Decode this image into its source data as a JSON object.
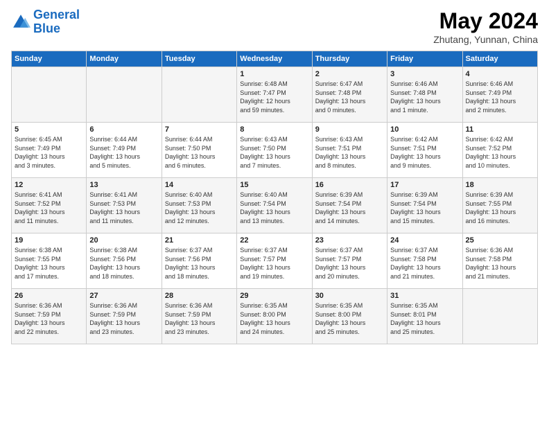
{
  "logo": {
    "line1": "General",
    "line2": "Blue"
  },
  "title": "May 2024",
  "subtitle": "Zhutang, Yunnan, China",
  "days_header": [
    "Sunday",
    "Monday",
    "Tuesday",
    "Wednesday",
    "Thursday",
    "Friday",
    "Saturday"
  ],
  "weeks": [
    [
      {
        "day": "",
        "content": ""
      },
      {
        "day": "",
        "content": ""
      },
      {
        "day": "",
        "content": ""
      },
      {
        "day": "1",
        "content": "Sunrise: 6:48 AM\nSunset: 7:47 PM\nDaylight: 12 hours\nand 59 minutes."
      },
      {
        "day": "2",
        "content": "Sunrise: 6:47 AM\nSunset: 7:48 PM\nDaylight: 13 hours\nand 0 minutes."
      },
      {
        "day": "3",
        "content": "Sunrise: 6:46 AM\nSunset: 7:48 PM\nDaylight: 13 hours\nand 1 minute."
      },
      {
        "day": "4",
        "content": "Sunrise: 6:46 AM\nSunset: 7:49 PM\nDaylight: 13 hours\nand 2 minutes."
      }
    ],
    [
      {
        "day": "5",
        "content": "Sunrise: 6:45 AM\nSunset: 7:49 PM\nDaylight: 13 hours\nand 3 minutes."
      },
      {
        "day": "6",
        "content": "Sunrise: 6:44 AM\nSunset: 7:49 PM\nDaylight: 13 hours\nand 5 minutes."
      },
      {
        "day": "7",
        "content": "Sunrise: 6:44 AM\nSunset: 7:50 PM\nDaylight: 13 hours\nand 6 minutes."
      },
      {
        "day": "8",
        "content": "Sunrise: 6:43 AM\nSunset: 7:50 PM\nDaylight: 13 hours\nand 7 minutes."
      },
      {
        "day": "9",
        "content": "Sunrise: 6:43 AM\nSunset: 7:51 PM\nDaylight: 13 hours\nand 8 minutes."
      },
      {
        "day": "10",
        "content": "Sunrise: 6:42 AM\nSunset: 7:51 PM\nDaylight: 13 hours\nand 9 minutes."
      },
      {
        "day": "11",
        "content": "Sunrise: 6:42 AM\nSunset: 7:52 PM\nDaylight: 13 hours\nand 10 minutes."
      }
    ],
    [
      {
        "day": "12",
        "content": "Sunrise: 6:41 AM\nSunset: 7:52 PM\nDaylight: 13 hours\nand 11 minutes."
      },
      {
        "day": "13",
        "content": "Sunrise: 6:41 AM\nSunset: 7:53 PM\nDaylight: 13 hours\nand 11 minutes."
      },
      {
        "day": "14",
        "content": "Sunrise: 6:40 AM\nSunset: 7:53 PM\nDaylight: 13 hours\nand 12 minutes."
      },
      {
        "day": "15",
        "content": "Sunrise: 6:40 AM\nSunset: 7:54 PM\nDaylight: 13 hours\nand 13 minutes."
      },
      {
        "day": "16",
        "content": "Sunrise: 6:39 AM\nSunset: 7:54 PM\nDaylight: 13 hours\nand 14 minutes."
      },
      {
        "day": "17",
        "content": "Sunrise: 6:39 AM\nSunset: 7:54 PM\nDaylight: 13 hours\nand 15 minutes."
      },
      {
        "day": "18",
        "content": "Sunrise: 6:39 AM\nSunset: 7:55 PM\nDaylight: 13 hours\nand 16 minutes."
      }
    ],
    [
      {
        "day": "19",
        "content": "Sunrise: 6:38 AM\nSunset: 7:55 PM\nDaylight: 13 hours\nand 17 minutes."
      },
      {
        "day": "20",
        "content": "Sunrise: 6:38 AM\nSunset: 7:56 PM\nDaylight: 13 hours\nand 18 minutes."
      },
      {
        "day": "21",
        "content": "Sunrise: 6:37 AM\nSunset: 7:56 PM\nDaylight: 13 hours\nand 18 minutes."
      },
      {
        "day": "22",
        "content": "Sunrise: 6:37 AM\nSunset: 7:57 PM\nDaylight: 13 hours\nand 19 minutes."
      },
      {
        "day": "23",
        "content": "Sunrise: 6:37 AM\nSunset: 7:57 PM\nDaylight: 13 hours\nand 20 minutes."
      },
      {
        "day": "24",
        "content": "Sunrise: 6:37 AM\nSunset: 7:58 PM\nDaylight: 13 hours\nand 21 minutes."
      },
      {
        "day": "25",
        "content": "Sunrise: 6:36 AM\nSunset: 7:58 PM\nDaylight: 13 hours\nand 21 minutes."
      }
    ],
    [
      {
        "day": "26",
        "content": "Sunrise: 6:36 AM\nSunset: 7:59 PM\nDaylight: 13 hours\nand 22 minutes."
      },
      {
        "day": "27",
        "content": "Sunrise: 6:36 AM\nSunset: 7:59 PM\nDaylight: 13 hours\nand 23 minutes."
      },
      {
        "day": "28",
        "content": "Sunrise: 6:36 AM\nSunset: 7:59 PM\nDaylight: 13 hours\nand 23 minutes."
      },
      {
        "day": "29",
        "content": "Sunrise: 6:35 AM\nSunset: 8:00 PM\nDaylight: 13 hours\nand 24 minutes."
      },
      {
        "day": "30",
        "content": "Sunrise: 6:35 AM\nSunset: 8:00 PM\nDaylight: 13 hours\nand 25 minutes."
      },
      {
        "day": "31",
        "content": "Sunrise: 6:35 AM\nSunset: 8:01 PM\nDaylight: 13 hours\nand 25 minutes."
      },
      {
        "day": "",
        "content": ""
      }
    ]
  ]
}
